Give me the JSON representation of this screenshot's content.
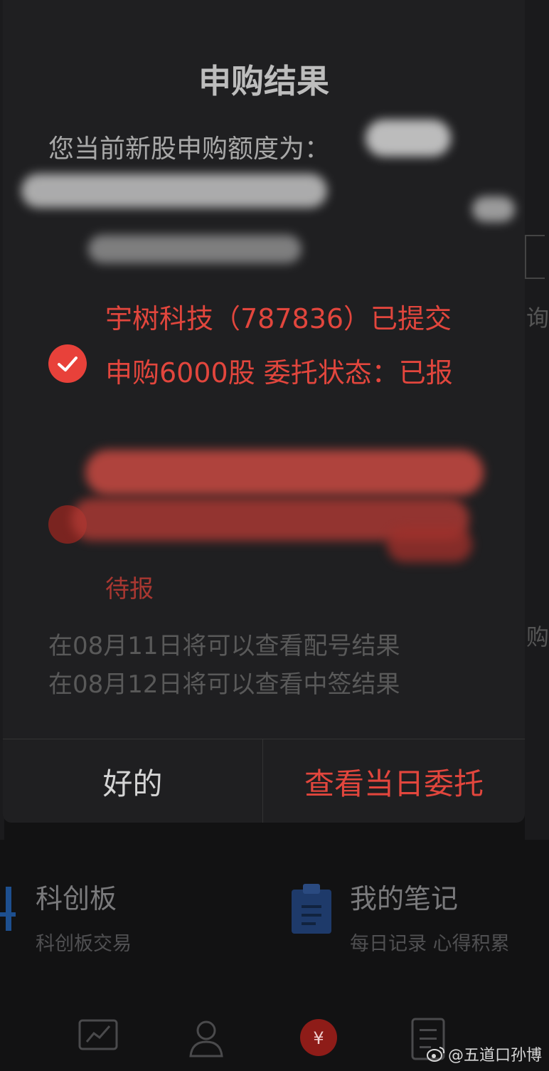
{
  "dialog": {
    "title": "申购结果",
    "quota_label": "您当前新股申购额度为：",
    "result_message": "宇树科技（787836）已提交申购6000股 委托状态：已报",
    "partial_status": "待报",
    "notices": [
      "在08月11日将可以查看配号结果",
      "在08月12日将可以查看中签结果"
    ],
    "ok_button": "好的",
    "view_button": "查看当日委托"
  },
  "background": {
    "right_fragments": [
      "询",
      "购"
    ],
    "quick_entries": [
      {
        "title": "科创板",
        "subtitle": "科创板交易",
        "icon": "kcb-icon"
      },
      {
        "title": "我的笔记",
        "subtitle": "每日记录 心得积累",
        "icon": "clipboard-icon"
      }
    ],
    "tabs": [
      {
        "icon": "chart-icon"
      },
      {
        "icon": "person-icon"
      },
      {
        "icon": "yen-icon"
      },
      {
        "icon": "document-icon"
      }
    ]
  },
  "watermark": "@五道口孙博",
  "colors": {
    "accent_red": "#e2463d",
    "dialog_bg": "#1f1f21",
    "page_bg": "#121213",
    "note_icon_blue": "#1e3a6a"
  }
}
